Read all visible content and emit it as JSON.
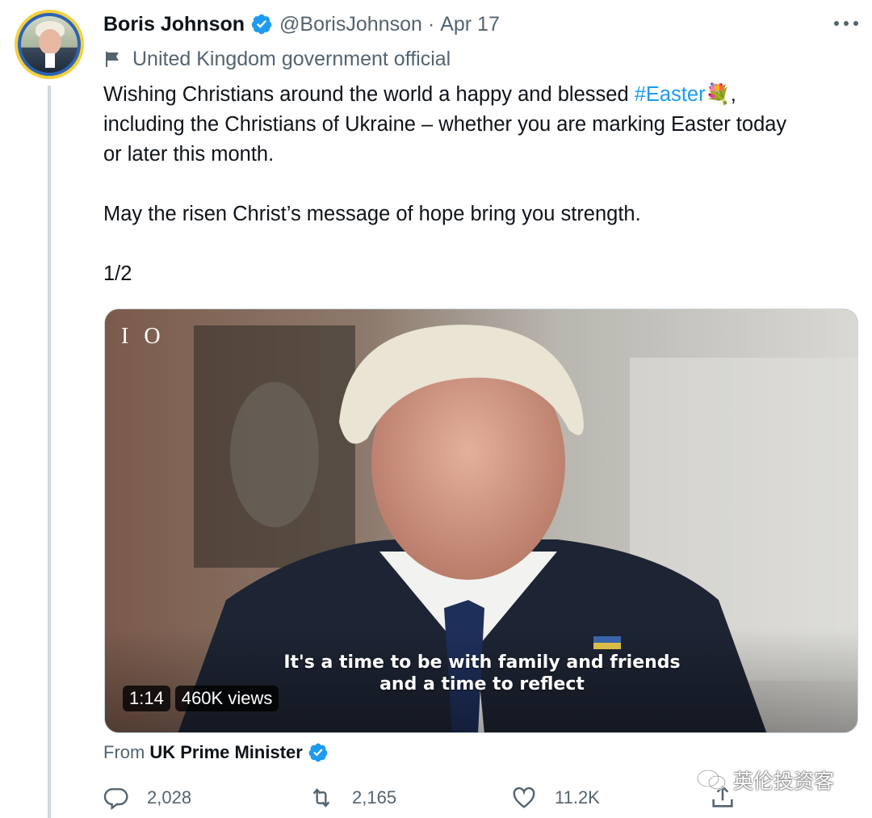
{
  "author": {
    "name": "Boris Johnson",
    "handle": "@BorisJohnson",
    "separator": "·",
    "date": "Apr 17",
    "label": "United Kingdom government official"
  },
  "tweet": {
    "line1_before": "Wishing Christians around the world a happy and blessed ",
    "hashtag": "#Easter",
    "emoji": "💐",
    "line1_after": ",",
    "line2": "including the Christians of Ukraine – whether you are marking Easter today",
    "line3": "or later this month.",
    "line4": "May the risen Christ’s message of hope bring you strength.",
    "line5": "1/2"
  },
  "video": {
    "channel_mark": "I O",
    "subtitle_line1": "It's a time to be with family and friends",
    "subtitle_line2": "and a time to reflect",
    "duration": "1:14",
    "views": "460K views"
  },
  "source": {
    "prefix": "From",
    "name": "UK Prime Minister"
  },
  "actions": {
    "replies": "2,028",
    "retweets": "2,165",
    "likes": "11.2K"
  },
  "watermark": {
    "text": "英伦投资客"
  },
  "colors": {
    "accent": "#1d9bf0",
    "secondary_text": "#536471",
    "avatar_ring": "#f4d03f"
  },
  "icons": [
    "verified-icon",
    "flag-icon",
    "more-icon",
    "reply-icon",
    "retweet-icon",
    "like-icon",
    "share-icon",
    "wechat-icon"
  ]
}
